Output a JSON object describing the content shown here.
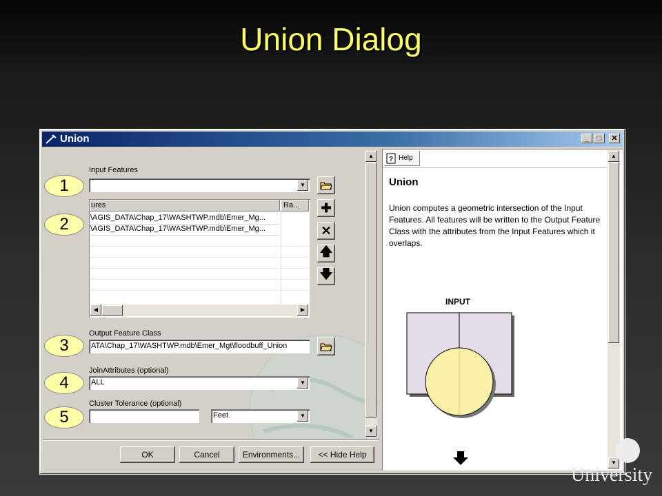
{
  "slide": {
    "title": "Union Dialog",
    "footer_logo": "University"
  },
  "window": {
    "title": "Union",
    "caption_buttons": {
      "minimize": "_",
      "maximize": "□",
      "close": "✕"
    }
  },
  "form": {
    "input_features_label": "Input Features",
    "input_features_value": "",
    "table": {
      "headers": [
        "ures",
        "Ra..."
      ],
      "rows": [
        [
          "\\AGIS_DATA\\Chap_17\\WASHTWP.mdb\\Emer_Mg...",
          ""
        ],
        [
          "\\AGIS_DATA\\Chap_17\\WASHTWP.mdb\\Emer_Mg...",
          ""
        ]
      ]
    },
    "output_label": "Output Feature Class",
    "output_value": "ATA\\Chap_17\\WASHTWP.mdb\\Emer_Mgt\\floodbuff_Union",
    "join_label": "JoinAttributes (optional)",
    "join_value": "ALL",
    "tolerance_label": "Cluster Tolerance (optional)",
    "tolerance_value": "",
    "tolerance_unit": "Feet"
  },
  "buttons": {
    "ok": "OK",
    "cancel": "Cancel",
    "environments": "Environments...",
    "hide_help": "<< Hide Help"
  },
  "callouts": [
    "1",
    "2",
    "3",
    "4",
    "5"
  ],
  "help": {
    "tab_label": "Help",
    "title": "Union",
    "body": "Union computes a geometric intersection of the Input Features. All features will be written to the Output Feature Class with the attributes from the Input Features which it overlaps.",
    "diagram_label": "INPUT"
  }
}
